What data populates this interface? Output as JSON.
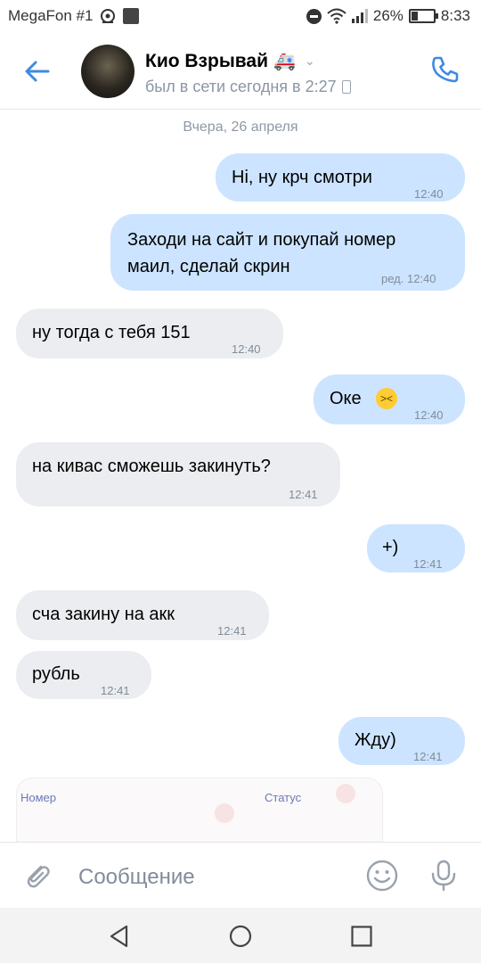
{
  "status_bar": {
    "carrier": "MegaFon #1",
    "battery": "26%",
    "time": "8:33"
  },
  "header": {
    "contact_name": "Кио Взрывай",
    "name_emoji": "🚑",
    "status": "был в сети сегодня в 2:27"
  },
  "chat": {
    "date_separator": "Вчера, 26 апреля",
    "messages": [
      {
        "direction": "out",
        "text": "Hi, ну крч смотри",
        "time": "12:40"
      },
      {
        "direction": "out",
        "text_line1": "Заходи на сайт и покупай номер",
        "text_line2": "маил, сделай скрин",
        "time": "ред. 12:40"
      },
      {
        "direction": "in",
        "text": "ну тогда с тебя 151",
        "time": "12:40"
      },
      {
        "direction": "out",
        "text": "Оке",
        "emoji": "grinning-squinting-face",
        "time": "12:40"
      },
      {
        "direction": "in",
        "text": "на кивас сможешь закинуть?",
        "time": "12:41"
      },
      {
        "direction": "out",
        "text": "+)",
        "time": "12:41"
      },
      {
        "direction": "in",
        "text": "сча закину на акк",
        "time": "12:41"
      },
      {
        "direction": "in",
        "text": "рубль",
        "time": "12:41"
      },
      {
        "direction": "out",
        "text": "Жду)",
        "time": "12:41"
      }
    ],
    "attachment": {
      "col1": "Номер",
      "col2": "Статус"
    }
  },
  "input": {
    "placeholder": "Сообщение"
  },
  "colors": {
    "accent": "#3f8ae0",
    "outgoing_bubble": "#cce4ff",
    "incoming_bubble": "#ebedf0"
  }
}
